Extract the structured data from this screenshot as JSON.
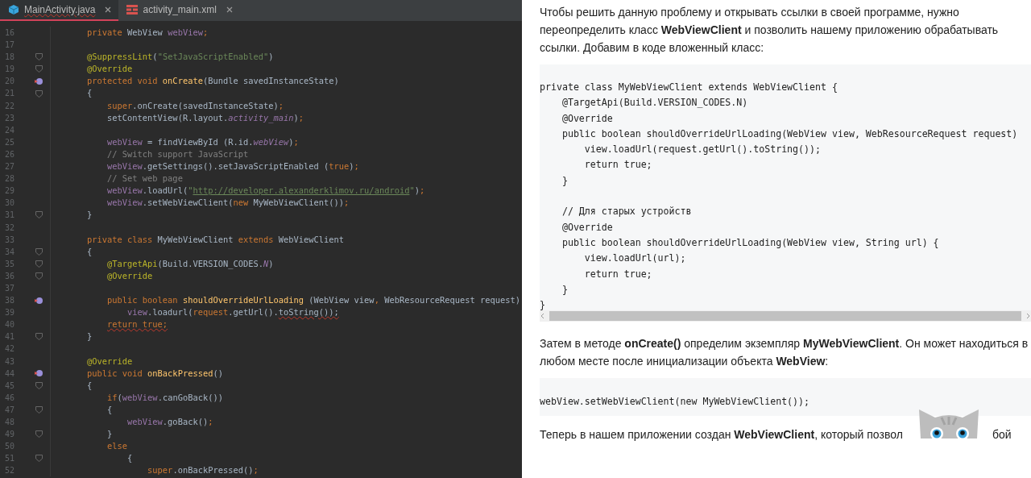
{
  "editor": {
    "tabs": [
      {
        "label": "MainActivity.java",
        "kind": "java",
        "selected": true
      },
      {
        "label": "activity_main.xml",
        "kind": "xml",
        "selected": false
      }
    ],
    "lines": [
      {
        "number": "16",
        "fold": false,
        "override": false,
        "tokens": [
          {
            "kind": "keyword",
            "text": "    private "
          },
          {
            "kind": "plain",
            "text": "WebView "
          },
          {
            "kind": "field",
            "text": "webView"
          },
          {
            "kind": "keyword",
            "text": ";"
          }
        ]
      },
      {
        "number": "17",
        "fold": false,
        "override": false
      },
      {
        "number": "18",
        "fold": true,
        "override": false,
        "tokens": [
          {
            "kind": "annotation",
            "text": "    @SuppressLint"
          },
          {
            "kind": "plain",
            "text": "("
          },
          {
            "kind": "string",
            "text": "\"SetJavaScriptEnabled\""
          },
          {
            "kind": "plain",
            "text": ")"
          }
        ]
      },
      {
        "number": "19",
        "fold": true,
        "override": false,
        "tokens": [
          {
            "kind": "annotation",
            "text": "    @Override"
          }
        ]
      },
      {
        "number": "20",
        "fold": false,
        "override": true,
        "tokens": [
          {
            "kind": "keyword",
            "text": "    protected void "
          },
          {
            "kind": "method",
            "text": "onCreate"
          },
          {
            "kind": "plain",
            "text": "(Bundle savedInstanceState)"
          }
        ]
      },
      {
        "number": "21",
        "fold": true,
        "override": false,
        "tokens": [
          {
            "kind": "plain",
            "text": "    {"
          }
        ]
      },
      {
        "number": "22",
        "fold": false,
        "override": false,
        "tokens": [
          {
            "kind": "keyword",
            "text": "        super"
          },
          {
            "kind": "plain",
            "text": ".onCreate(savedInstanceState)"
          },
          {
            "kind": "keyword",
            "text": ";"
          }
        ]
      },
      {
        "number": "23",
        "fold": false,
        "override": false,
        "tokens": [
          {
            "kind": "plain",
            "text": "        setContentView(R.layout."
          },
          {
            "kind": "field-italic",
            "text": "activity_main"
          },
          {
            "kind": "plain",
            "text": ")"
          },
          {
            "kind": "keyword",
            "text": ";"
          }
        ]
      },
      {
        "number": "24",
        "fold": false,
        "override": false
      },
      {
        "number": "25",
        "fold": false,
        "override": false,
        "tokens": [
          {
            "kind": "field",
            "text": "        webView"
          },
          {
            "kind": "plain",
            "text": " = findViewById (R.id."
          },
          {
            "kind": "field-italic",
            "text": "webView"
          },
          {
            "kind": "plain",
            "text": ")"
          },
          {
            "kind": "keyword",
            "text": ";"
          }
        ]
      },
      {
        "number": "26",
        "fold": false,
        "override": false,
        "tokens": [
          {
            "kind": "comment",
            "text": "        // Switch support JavaScript"
          }
        ]
      },
      {
        "number": "27",
        "fold": false,
        "override": false,
        "tokens": [
          {
            "kind": "field",
            "text": "        webView"
          },
          {
            "kind": "plain",
            "text": ".getSettings().setJavaScriptEnabled ("
          },
          {
            "kind": "keyword",
            "text": "true"
          },
          {
            "kind": "plain",
            "text": ")"
          },
          {
            "kind": "keyword",
            "text": ";"
          }
        ]
      },
      {
        "number": "28",
        "fold": false,
        "override": false,
        "tokens": [
          {
            "kind": "comment",
            "text": "        // Set web page"
          }
        ]
      },
      {
        "number": "29",
        "fold": false,
        "override": false,
        "tokens": [
          {
            "kind": "field",
            "text": "        webView"
          },
          {
            "kind": "plain",
            "text": ".loadUrl("
          },
          {
            "kind": "string",
            "text": "\""
          },
          {
            "kind": "link",
            "text": "http://developer.alexanderklimov.ru/android"
          },
          {
            "kind": "string",
            "text": "\""
          },
          {
            "kind": "plain",
            "text": ")"
          },
          {
            "kind": "keyword",
            "text": ";"
          }
        ]
      },
      {
        "number": "30",
        "fold": false,
        "override": false,
        "tokens": [
          {
            "kind": "field",
            "text": "        webView"
          },
          {
            "kind": "plain",
            "text": ".setWebViewClient("
          },
          {
            "kind": "keyword",
            "text": "new "
          },
          {
            "kind": "plain",
            "text": "MyWebViewClient())"
          },
          {
            "kind": "keyword",
            "text": ";"
          }
        ]
      },
      {
        "number": "31",
        "fold": true,
        "override": false,
        "tokens": [
          {
            "kind": "plain",
            "text": "    }"
          }
        ]
      },
      {
        "number": "32",
        "fold": false,
        "override": false
      },
      {
        "number": "33",
        "fold": false,
        "override": false,
        "tokens": [
          {
            "kind": "keyword",
            "text": "    private class "
          },
          {
            "kind": "plain",
            "text": "MyWebViewClient "
          },
          {
            "kind": "keyword",
            "text": "extends "
          },
          {
            "kind": "plain",
            "text": "WebViewClient"
          }
        ]
      },
      {
        "number": "34",
        "fold": true,
        "override": false,
        "tokens": [
          {
            "kind": "plain",
            "text": "    {"
          }
        ]
      },
      {
        "number": "35",
        "fold": true,
        "override": false,
        "tokens": [
          {
            "kind": "annotation",
            "text": "        @TargetApi"
          },
          {
            "kind": "plain",
            "text": "(Build.VERSION_CODES."
          },
          {
            "kind": "field-italic",
            "text": "N"
          },
          {
            "kind": "plain",
            "text": ")"
          }
        ]
      },
      {
        "number": "36",
        "fold": true,
        "override": false,
        "tokens": [
          {
            "kind": "annotation",
            "text": "        @Override"
          }
        ]
      },
      {
        "number": "37",
        "fold": false,
        "override": false
      },
      {
        "number": "38",
        "fold": false,
        "override": true,
        "tokens": [
          {
            "kind": "keyword",
            "text": "        public boolean "
          },
          {
            "kind": "method",
            "text": "shouldOverrideUrlLoading"
          },
          {
            "kind": "plain",
            "text": " (WebView view"
          },
          {
            "kind": "keyword",
            "text": ", "
          },
          {
            "kind": "plain",
            "text": "WebResourceRequest request)"
          }
        ]
      },
      {
        "number": "39",
        "fold": false,
        "override": false,
        "tokens": [
          {
            "kind": "field",
            "text": "            view"
          },
          {
            "kind": "plain",
            "text": ".loadurl("
          },
          {
            "kind": "keyword",
            "text": "request"
          },
          {
            "kind": "plain",
            "text": ".getUrl()."
          },
          {
            "kind": "error",
            "text": "toString());"
          }
        ]
      },
      {
        "number": "40",
        "fold": false,
        "override": false,
        "tokens": [
          {
            "kind": "error-keyword",
            "text": "        return true;"
          }
        ]
      },
      {
        "number": "41",
        "fold": true,
        "override": false,
        "tokens": [
          {
            "kind": "plain",
            "text": "    }"
          }
        ]
      },
      {
        "number": "42",
        "fold": false,
        "override": false
      },
      {
        "number": "43",
        "fold": false,
        "override": false,
        "tokens": [
          {
            "kind": "annotation",
            "text": "    @Override"
          }
        ]
      },
      {
        "number": "44",
        "fold": false,
        "override": true,
        "tokens": [
          {
            "kind": "keyword",
            "text": "    public void "
          },
          {
            "kind": "method",
            "text": "onBackPressed"
          },
          {
            "kind": "plain",
            "text": "()"
          }
        ]
      },
      {
        "number": "45",
        "fold": true,
        "override": false,
        "tokens": [
          {
            "kind": "plain",
            "text": "    {"
          }
        ]
      },
      {
        "number": "46",
        "fold": false,
        "override": false,
        "tokens": [
          {
            "kind": "keyword",
            "text": "        if"
          },
          {
            "kind": "plain",
            "text": "("
          },
          {
            "kind": "field",
            "text": "webView"
          },
          {
            "kind": "plain",
            "text": ".canGoBack())"
          }
        ]
      },
      {
        "number": "47",
        "fold": true,
        "override": false,
        "tokens": [
          {
            "kind": "plain",
            "text": "        {"
          }
        ]
      },
      {
        "number": "48",
        "fold": false,
        "override": false,
        "tokens": [
          {
            "kind": "field",
            "text": "            webView"
          },
          {
            "kind": "plain",
            "text": ".goBack()"
          },
          {
            "kind": "keyword",
            "text": ";"
          }
        ]
      },
      {
        "number": "49",
        "fold": true,
        "override": false,
        "tokens": [
          {
            "kind": "plain",
            "text": "        }"
          }
        ]
      },
      {
        "number": "50",
        "fold": false,
        "override": false,
        "tokens": [
          {
            "kind": "keyword",
            "text": "        else"
          }
        ]
      },
      {
        "number": "51",
        "fold": true,
        "override": false,
        "tokens": [
          {
            "kind": "plain",
            "text": "            {"
          }
        ]
      },
      {
        "number": "52",
        "fold": false,
        "override": false,
        "tokens": [
          {
            "kind": "keyword",
            "text": "                super"
          },
          {
            "kind": "plain",
            "text": ".onBackPressed()"
          },
          {
            "kind": "keyword",
            "text": ";"
          }
        ]
      }
    ]
  },
  "article": {
    "blocks": [
      {
        "kind": "paragraph",
        "text": "Чтобы решить данную проблему и открывать ссылки в своей программе, нужно переопределить класс **WebViewClient** и позволить нашему приложению обрабатывать ссылки. Добавим в коде вложенный класс:"
      },
      {
        "kind": "code",
        "scrollbar": true,
        "lines": [
          {
            "text": "private class MyWebViewClient extends WebViewClient {"
          },
          {
            "text": "    @TargetApi(Build.VERSION_CODES.N)"
          },
          {
            "text": "    @Override"
          },
          {
            "text": "    public boolean shouldOverrideUrlLoading(WebView view, WebResourceRequest request)"
          },
          {
            "text": "        view.loadUrl(request.getUrl().toString());"
          },
          {
            "text": "        return true;"
          },
          {
            "text": "    }"
          },
          {
            "text": "    // Для старых устройств",
            "gap_before": true
          },
          {
            "text": "    @Override"
          },
          {
            "text": "    public boolean shouldOverrideUrlLoading(WebView view, String url) {"
          },
          {
            "text": "        view.loadUrl(url);"
          },
          {
            "text": "        return true;"
          },
          {
            "text": "    }"
          },
          {
            "text": "}"
          }
        ]
      },
      {
        "kind": "paragraph",
        "text": "Затем в методе **onCreate()** определим экземпляр **MyWebViewClient**. Он может находиться в любом месте после инициализации объекта **WebView**:"
      },
      {
        "kind": "code",
        "scrollbar": false,
        "lines": [
          {
            "text": "webView.setWebViewClient(new MyWebViewClient());"
          }
        ]
      },
      {
        "kind": "partial",
        "text": "Теперь в нашем приложении создан **WebViewClient**, который позвол",
        "tail": "бой"
      }
    ]
  }
}
